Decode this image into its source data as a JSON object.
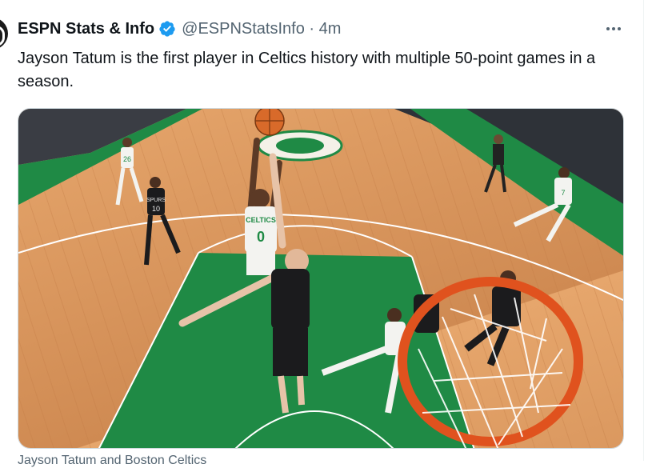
{
  "tweet": {
    "author_name": "ESPN Stats & Info",
    "handle_time": "@ESPNStatsInfo · 4m",
    "text": "Jayson Tatum is the first player in Celtics history with multiple 50-point games in a season.",
    "more_icon": "more-horizontal-icon",
    "verified_icon": "verified-badge-icon",
    "verified_color": "#1d9bf0"
  },
  "media": {
    "jerseys": {
      "tatum": "CELTICS",
      "tatum_number": "0",
      "spurs_left": "SPURS",
      "spurs_left_number": "10",
      "celtics_left_number": "26",
      "celtics_right_number": "7"
    },
    "colors": {
      "floor": "#d9955a",
      "paint": "#1f8a45",
      "rim": "#e0521e"
    }
  },
  "caption": "Jayson Tatum and Boston Celtics"
}
